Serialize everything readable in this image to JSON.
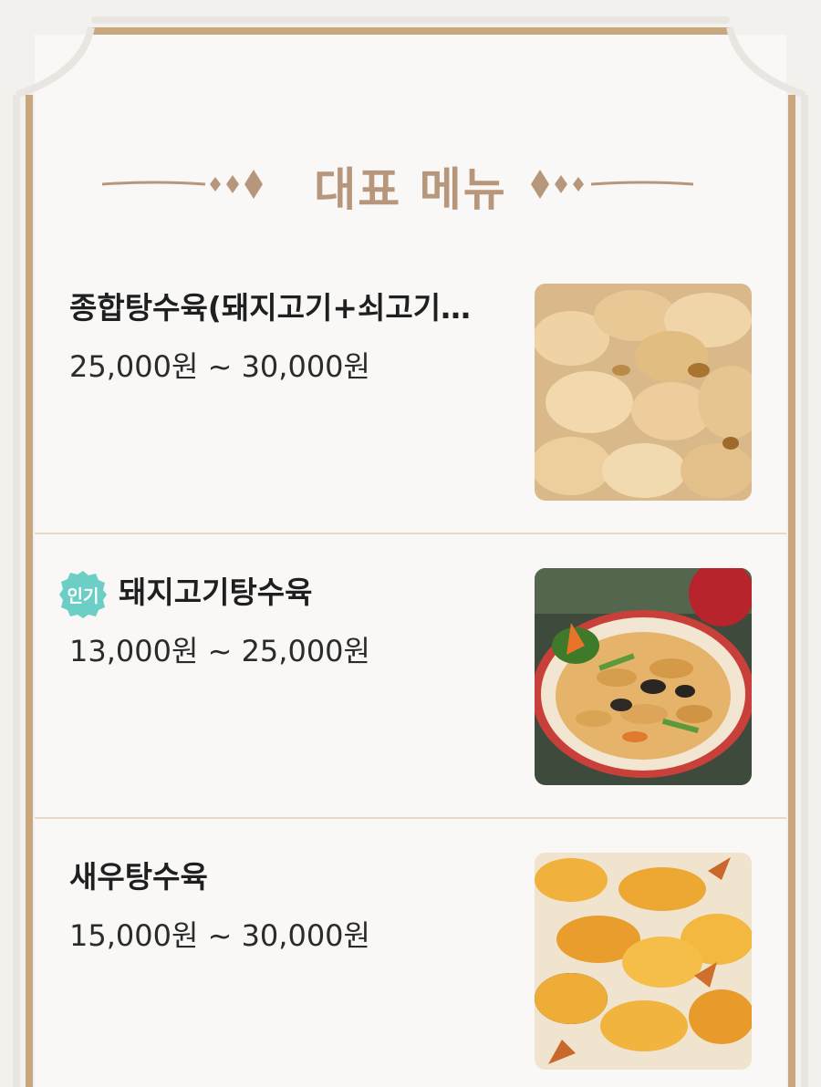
{
  "section": {
    "title": "대표 메뉴"
  },
  "colors": {
    "accent": "#b7977b",
    "frame": "#c8a77f",
    "badge": "#6ccfc5",
    "divider": "#e8d9c9"
  },
  "menu": {
    "items": [
      {
        "name": "종합탕수육(돼지고기+쇠고기…",
        "price": "25,000원 ~ 30,000원",
        "image": "fried-pork-and-beef-photo"
      },
      {
        "badge": "인기",
        "name": "돼지고기탕수육",
        "price": "13,000원 ~ 25,000원",
        "image": "sweet-and-sour-pork-plate-photo"
      },
      {
        "name": "새우탕수육",
        "price": "15,000원 ~ 30,000원",
        "image": "fried-shrimp-photo"
      }
    ]
  }
}
